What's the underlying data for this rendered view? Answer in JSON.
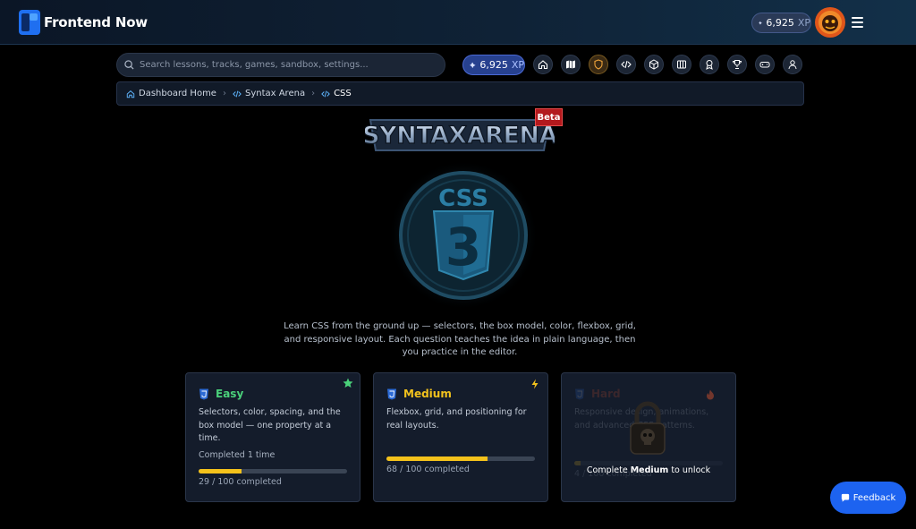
{
  "app": {
    "brand": "Frontend Now"
  },
  "header": {
    "xp_value": "6,925",
    "xp_unit": "XP"
  },
  "search": {
    "placeholder": "Search lessons, tracks, games, sandbox, settings..."
  },
  "toolbar": {
    "xp_value": "6,925",
    "xp_unit": "XP",
    "icons": [
      "home-icon",
      "map-icon",
      "shield-icon",
      "code-icon",
      "cube-icon",
      "book-icon",
      "award-icon",
      "trophy-icon",
      "gamepad-icon",
      "user-icon"
    ]
  },
  "breadcrumb": [
    {
      "label": "Dashboard Home",
      "icon": "home-icon"
    },
    {
      "label": "Syntax Arena",
      "icon": "code-icon"
    },
    {
      "label": "CSS",
      "icon": "code-icon"
    }
  ],
  "hero": {
    "arena_title": "SYNTAXARENA",
    "badge": "Beta",
    "emblem_text": "CSS",
    "emblem_number": "3",
    "description": "Learn CSS from the ground up — selectors, the box model, color, flexbox, grid, and responsive layout. Each question teaches the idea in plain language, then you practice in the editor."
  },
  "cards": {
    "easy": {
      "title": "Easy",
      "color": "#4ad17a",
      "description": "Selectors, color, spacing, and the box model — one property at a time.",
      "completed": "Completed 1 time",
      "progress": 0.29,
      "count": "29 / 100 completed"
    },
    "medium": {
      "title": "Medium",
      "color": "#f2c21d",
      "description": "Flexbox, grid, and positioning for real layouts.",
      "progress": 0.68,
      "count": "68 / 100 completed"
    },
    "hard": {
      "title": "Hard",
      "color": "#e5562e",
      "description": "Responsive design, animations, and advanced CSS patterns.",
      "progress": 0.04,
      "count": "4 / 100 completed",
      "locked": true,
      "unlock_prefix": "Complete ",
      "unlock_level": "Medium",
      "unlock_suffix": " to unlock"
    }
  },
  "feedback": {
    "label": "Feedback"
  },
  "colors": {
    "accent": "#1d63f0",
    "xp_blue": "#27418f",
    "progress": "#f4c21b"
  }
}
